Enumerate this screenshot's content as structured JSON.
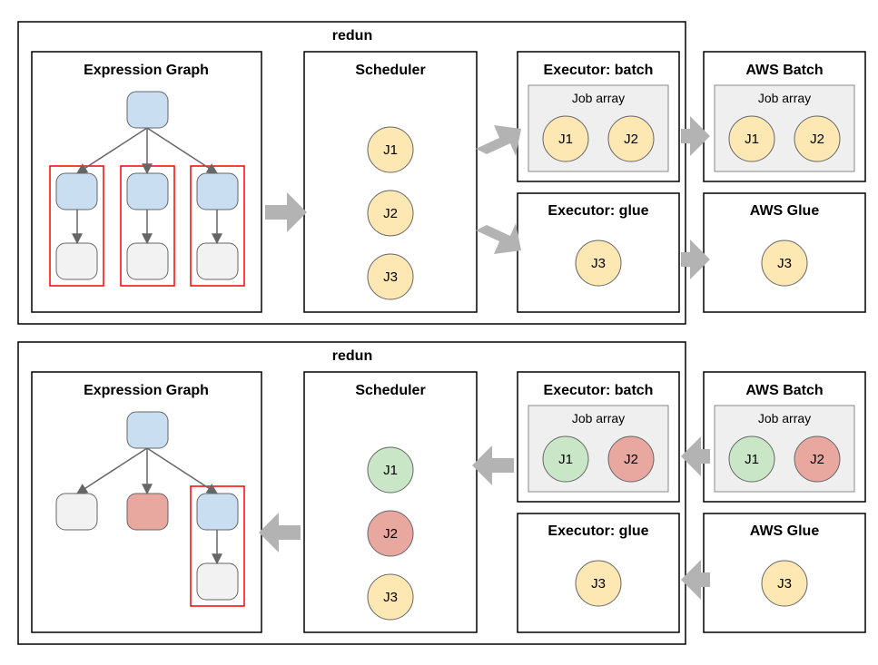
{
  "chart_data": {
    "type": "flow-diagram",
    "description": "Two stacked pipeline diagrams showing how redun dispatches jobs from an expression graph through a scheduler to batch/glue executors and then to AWS Batch / AWS Glue services. Top row shows dispatch (left→right); bottom row shows results returning (right→left).",
    "rows": [
      {
        "direction": "left_to_right",
        "container_label": "redun",
        "panels": [
          {
            "id": "expr_top",
            "title": "Expression Graph",
            "content": "tree of 1 root node → 3 children → 3 grandchildren; each child+grandchild pair outlined in red to indicate pending subtrees"
          },
          {
            "id": "sched_top",
            "title": "Scheduler",
            "jobs": [
              {
                "name": "J1",
                "state": "pending"
              },
              {
                "name": "J2",
                "state": "pending"
              },
              {
                "name": "J3",
                "state": "pending"
              }
            ]
          },
          {
            "id": "exec_batch_top",
            "title": "Executor: batch",
            "job_array_label": "Job array",
            "jobs": [
              {
                "name": "J1",
                "state": "pending"
              },
              {
                "name": "J2",
                "state": "pending"
              }
            ]
          },
          {
            "id": "exec_glue_top",
            "title": "Executor: glue",
            "jobs": [
              {
                "name": "J3",
                "state": "pending"
              }
            ]
          },
          {
            "id": "aws_batch_top",
            "title": "AWS Batch",
            "job_array_label": "Job array",
            "jobs": [
              {
                "name": "J1",
                "state": "pending"
              },
              {
                "name": "J2",
                "state": "pending"
              }
            ]
          },
          {
            "id": "aws_glue_top",
            "title": "AWS Glue",
            "jobs": [
              {
                "name": "J3",
                "state": "pending"
              }
            ]
          }
        ],
        "arrows": [
          {
            "from": "expr_top",
            "to": "sched_top"
          },
          {
            "from": "sched_top",
            "to": "exec_batch_top"
          },
          {
            "from": "sched_top",
            "to": "exec_glue_top"
          },
          {
            "from": "exec_batch_top",
            "to": "aws_batch_top"
          },
          {
            "from": "exec_glue_top",
            "to": "aws_glue_top"
          }
        ]
      },
      {
        "direction": "right_to_left",
        "container_label": "redun",
        "panels": [
          {
            "id": "expr_bot",
            "title": "Expression Graph",
            "content": "root node with 3 children; first child done (grey), second child failed (red), third child+grandchild still pending (blue subtree outlined in red)"
          },
          {
            "id": "sched_bot",
            "title": "Scheduler",
            "jobs": [
              {
                "name": "J1",
                "state": "success"
              },
              {
                "name": "J2",
                "state": "failed"
              },
              {
                "name": "J3",
                "state": "pending"
              }
            ]
          },
          {
            "id": "exec_batch_bot",
            "title": "Executor: batch",
            "job_array_label": "Job array",
            "jobs": [
              {
                "name": "J1",
                "state": "success"
              },
              {
                "name": "J2",
                "state": "failed"
              }
            ]
          },
          {
            "id": "exec_glue_bot",
            "title": "Executor: glue",
            "jobs": [
              {
                "name": "J3",
                "state": "pending"
              }
            ]
          },
          {
            "id": "aws_batch_bot",
            "title": "AWS Batch",
            "job_array_label": "Job array",
            "jobs": [
              {
                "name": "J1",
                "state": "success"
              },
              {
                "name": "J2",
                "state": "failed"
              }
            ]
          },
          {
            "id": "aws_glue_bot",
            "title": "AWS Glue",
            "jobs": [
              {
                "name": "J3",
                "state": "pending"
              }
            ]
          }
        ],
        "arrows": [
          {
            "from": "aws_batch_bot",
            "to": "exec_batch_bot"
          },
          {
            "from": "aws_glue_bot",
            "to": "exec_glue_bot"
          },
          {
            "from": "exec_batch_bot",
            "to": "sched_bot"
          },
          {
            "from": "sched_bot",
            "to": "expr_bot"
          }
        ]
      }
    ],
    "state_colors": {
      "pending": "#fde8b4",
      "success": "#c9e7c7",
      "failed": "#e8a89f",
      "node_blue": "#cadef1",
      "node_grey": "#f2f2f2"
    }
  },
  "labels": {
    "redun": "redun",
    "expr": "Expression Graph",
    "sched": "Scheduler",
    "exec_batch": "Executor: batch",
    "exec_glue": "Executor: glue",
    "aws_batch": "AWS Batch",
    "aws_glue": "AWS Glue",
    "job_array": "Job array",
    "J1": "J1",
    "J2": "J2",
    "J3": "J3"
  }
}
